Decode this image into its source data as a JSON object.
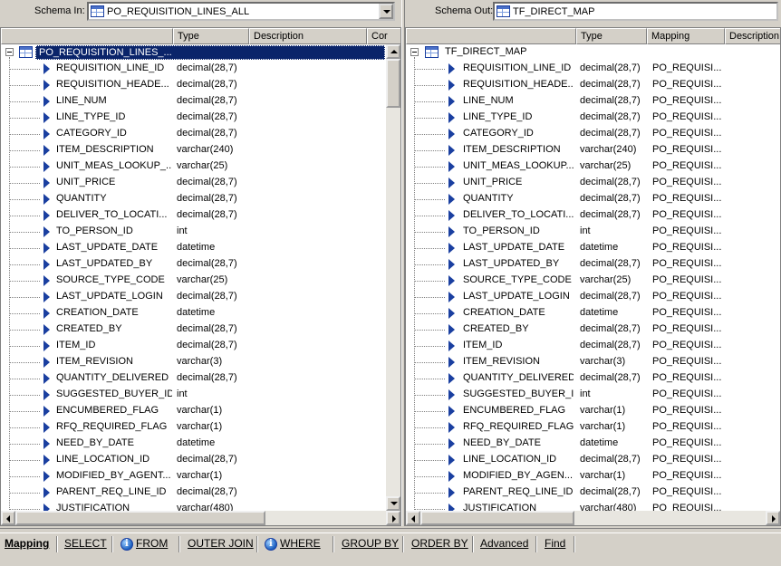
{
  "left": {
    "schema_label": "Schema In:",
    "schema_value": "PO_REQUISITION_LINES_ALL",
    "headers": [
      "",
      "Type",
      "Description",
      "Cor"
    ],
    "root_label": "PO_REQUISITION_LINES_..."
  },
  "right": {
    "schema_label": "Schema Out:",
    "schema_value": "TF_DIRECT_MAP",
    "headers": [
      "",
      "Type",
      "Mapping",
      "Description"
    ],
    "root_label": "TF_DIRECT_MAP"
  },
  "left_names": [
    "REQUISITION_LINE_ID",
    "REQUISITION_HEADE...",
    "LINE_NUM",
    "LINE_TYPE_ID",
    "CATEGORY_ID",
    "ITEM_DESCRIPTION",
    "UNIT_MEAS_LOOKUP_...",
    "UNIT_PRICE",
    "QUANTITY",
    "DELIVER_TO_LOCATI...",
    "TO_PERSON_ID",
    "LAST_UPDATE_DATE",
    "LAST_UPDATED_BY",
    "SOURCE_TYPE_CODE",
    "LAST_UPDATE_LOGIN",
    "CREATION_DATE",
    "CREATED_BY",
    "ITEM_ID",
    "ITEM_REVISION",
    "QUANTITY_DELIVERED",
    "SUGGESTED_BUYER_ID",
    "ENCUMBERED_FLAG",
    "RFQ_REQUIRED_FLAG",
    "NEED_BY_DATE",
    "LINE_LOCATION_ID",
    "MODIFIED_BY_AGENT...",
    "PARENT_REQ_LINE_ID",
    "JUSTIFICATION"
  ],
  "right_names": [
    "REQUISITION_LINE_ID",
    "REQUISITION_HEADE...",
    "LINE_NUM",
    "LINE_TYPE_ID",
    "CATEGORY_ID",
    "ITEM_DESCRIPTION",
    "UNIT_MEAS_LOOKUP...",
    "UNIT_PRICE",
    "QUANTITY",
    "DELIVER_TO_LOCATI...",
    "TO_PERSON_ID",
    "LAST_UPDATE_DATE",
    "LAST_UPDATED_BY",
    "SOURCE_TYPE_CODE",
    "LAST_UPDATE_LOGIN",
    "CREATION_DATE",
    "CREATED_BY",
    "ITEM_ID",
    "ITEM_REVISION",
    "QUANTITY_DELIVERED",
    "SUGGESTED_BUYER_ID",
    "ENCUMBERED_FLAG",
    "RFQ_REQUIRED_FLAG",
    "NEED_BY_DATE",
    "LINE_LOCATION_ID",
    "MODIFIED_BY_AGEN...",
    "PARENT_REQ_LINE_ID",
    "JUSTIFICATION"
  ],
  "types": [
    "decimal(28,7)",
    "decimal(28,7)",
    "decimal(28,7)",
    "decimal(28,7)",
    "decimal(28,7)",
    "varchar(240)",
    "varchar(25)",
    "decimal(28,7)",
    "decimal(28,7)",
    "decimal(28,7)",
    "int",
    "datetime",
    "decimal(28,7)",
    "varchar(25)",
    "decimal(28,7)",
    "datetime",
    "decimal(28,7)",
    "decimal(28,7)",
    "varchar(3)",
    "decimal(28,7)",
    "int",
    "varchar(1)",
    "varchar(1)",
    "datetime",
    "decimal(28,7)",
    "varchar(1)",
    "decimal(28,7)",
    "varchar(480)"
  ],
  "mapping_value": "PO_REQUISI...",
  "tabs": [
    {
      "label": "Mapping",
      "active": true,
      "icon": ""
    },
    {
      "label": "SELECT",
      "active": false,
      "icon": ""
    },
    {
      "label": "FROM",
      "active": false,
      "icon": "info-icon"
    },
    {
      "label": "OUTER JOIN",
      "active": false,
      "icon": ""
    },
    {
      "label": "WHERE",
      "active": false,
      "icon": "info-icon"
    },
    {
      "label": "GROUP BY",
      "active": false,
      "icon": ""
    },
    {
      "label": "ORDER BY",
      "active": false,
      "icon": ""
    },
    {
      "label": "Advanced",
      "active": false,
      "icon": ""
    },
    {
      "label": "Find",
      "active": false,
      "icon": ""
    }
  ],
  "colors": {
    "selection": "#0a246a",
    "field_icon": "#1a3fa0",
    "chrome": "#d4d0c8"
  }
}
